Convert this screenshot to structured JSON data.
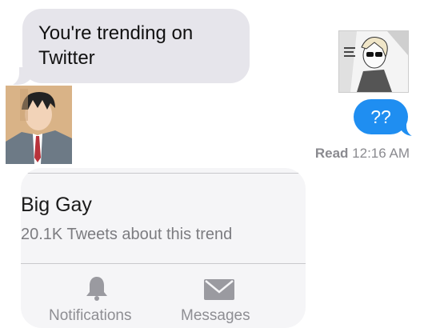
{
  "incoming_message": {
    "text": "You're trending on Twitter"
  },
  "outgoing_message": {
    "text": "??"
  },
  "read_receipt": {
    "status": "Read",
    "time": "12:16 AM"
  },
  "notification_card": {
    "trend_name": "Big Gay",
    "trend_count": "20.1K Tweets about this trend",
    "tabs": [
      {
        "label": "Notifications",
        "icon": "bell-icon"
      },
      {
        "label": "Messages",
        "icon": "envelope-icon"
      }
    ]
  },
  "colors": {
    "incoming_bubble": "#e6e5eb",
    "outgoing_bubble": "#1f8ef1",
    "muted_text": "#8a8a8f",
    "card_bg": "#f5f5f7"
  }
}
